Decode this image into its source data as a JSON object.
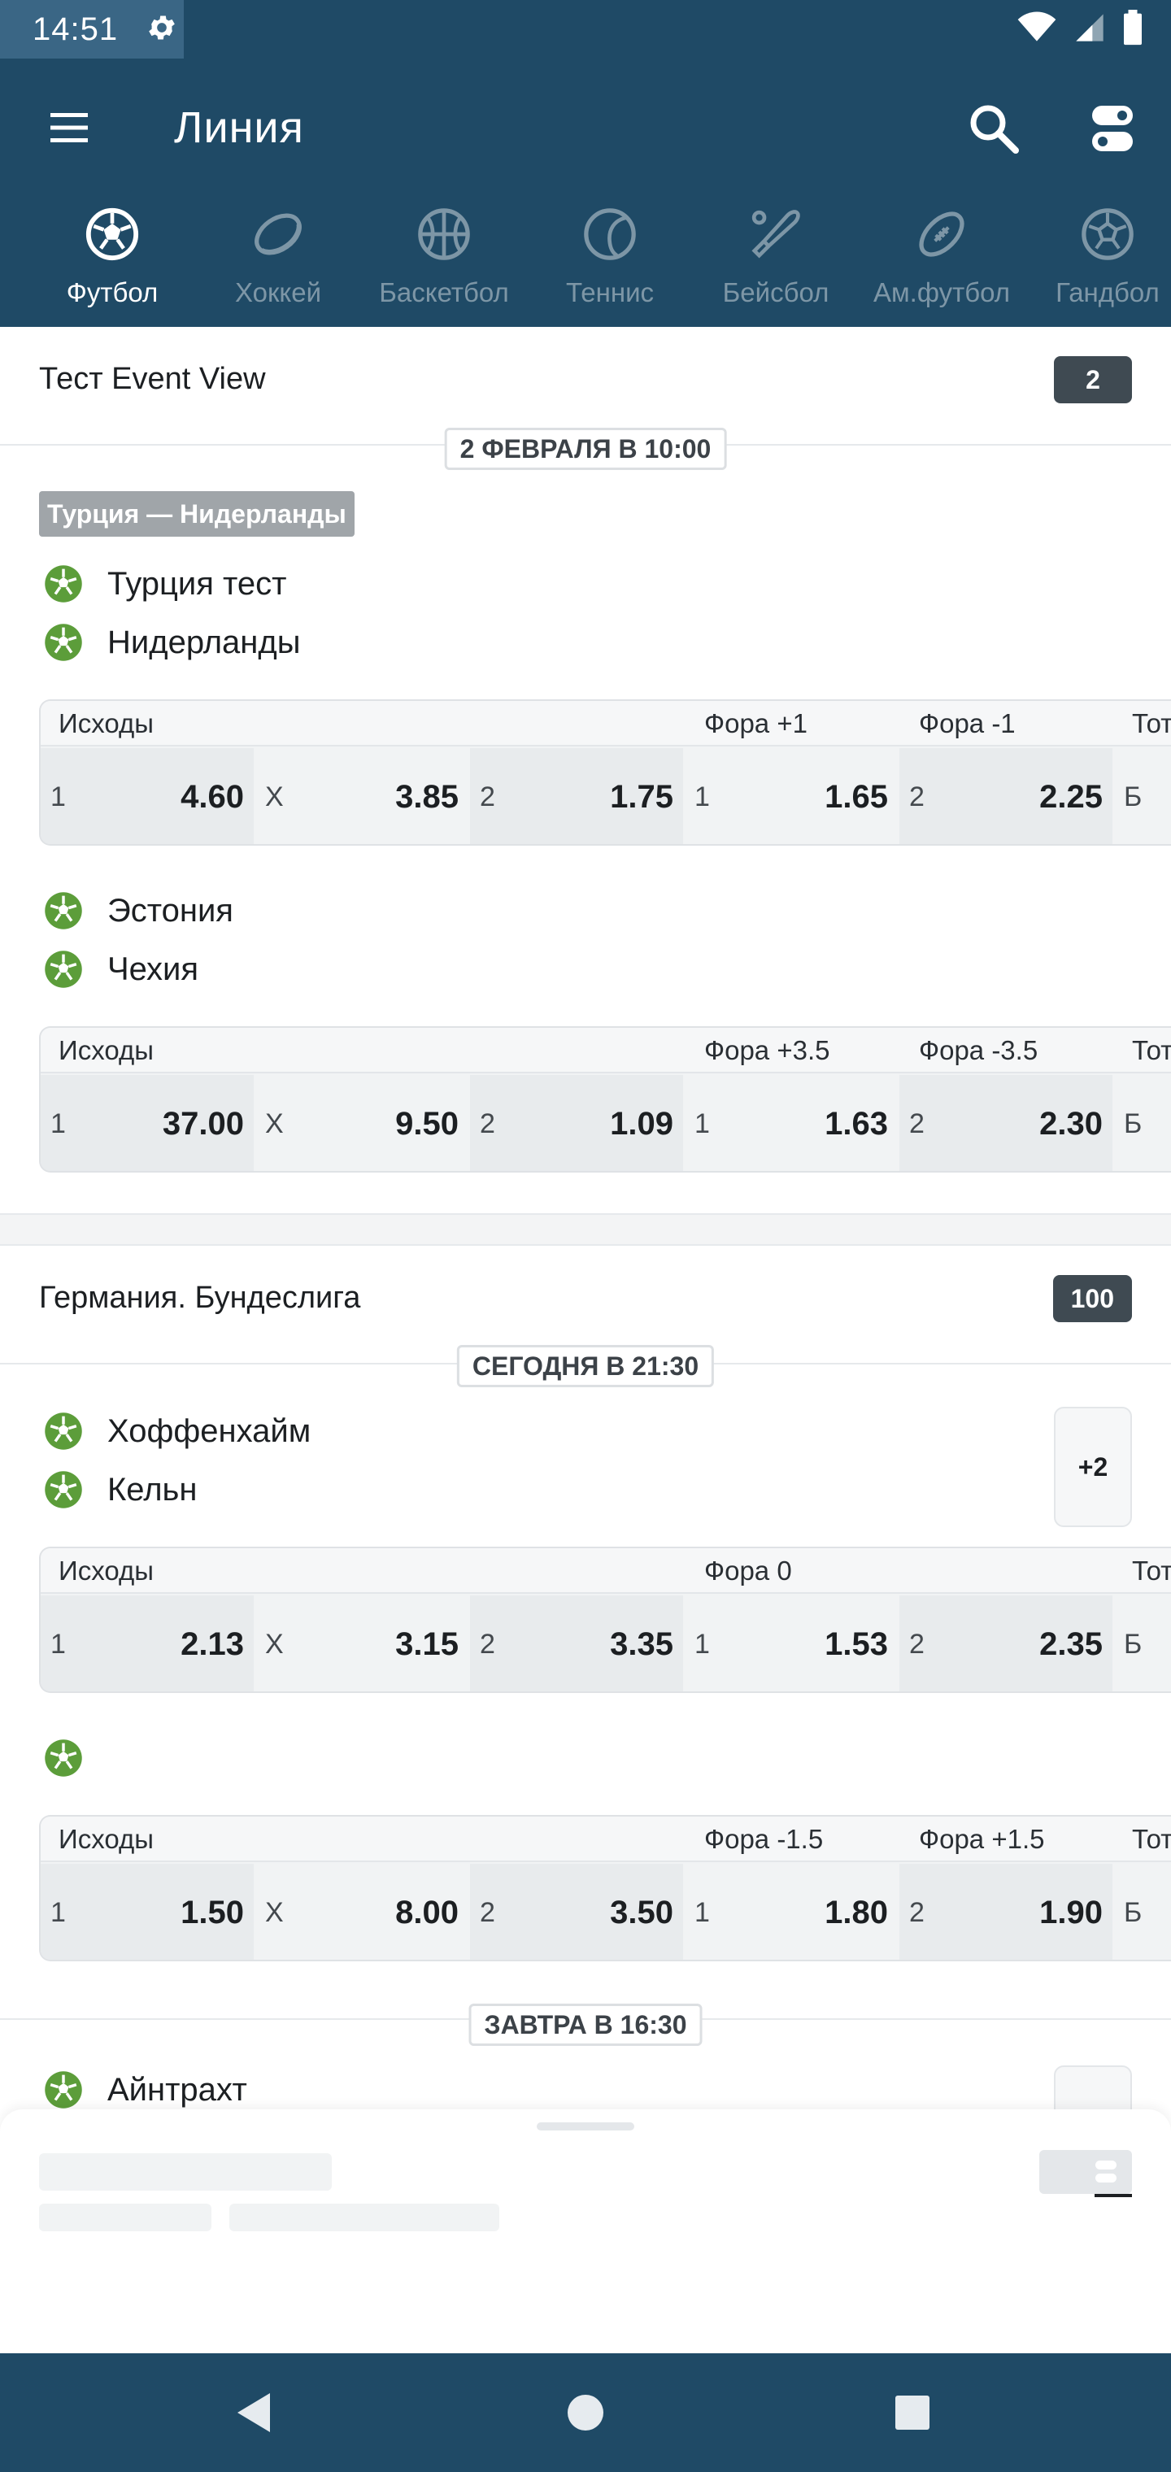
{
  "colors": {
    "primary": "#1f4a66",
    "count_badge": "#3f4a52",
    "soccer_icon": "#5c9d3a"
  },
  "status_bar": {
    "time": "14:51",
    "icons": [
      "gear-icon",
      "wifi-icon",
      "signal-icon",
      "battery-icon"
    ]
  },
  "app_bar": {
    "title": "Линия",
    "icons": [
      "menu-icon",
      "search-icon",
      "toggle-filter-icon"
    ]
  },
  "sports": [
    {
      "label": "Футбол",
      "icon": "soccer-ball-icon",
      "active": true
    },
    {
      "label": "Хоккей",
      "icon": "hockey-puck-icon",
      "active": false
    },
    {
      "label": "Баскетбол",
      "icon": "basketball-icon",
      "active": false
    },
    {
      "label": "Теннис",
      "icon": "tennis-ball-icon",
      "active": false
    },
    {
      "label": "Бейсбол",
      "icon": "baseball-bat-icon",
      "active": false
    },
    {
      "label": "Ам.футбол",
      "icon": "american-football-icon",
      "active": false
    },
    {
      "label": "Гандбол",
      "icon": "handball-icon",
      "active": false
    }
  ],
  "leagues": [
    {
      "name": "Тест Event View",
      "count": "2",
      "date": "2 ФЕВРАЛЯ В 10:00",
      "events": [
        {
          "tag": "Турция — Нидерланды",
          "teams": [
            "Турция тест",
            "Нидерланды"
          ],
          "market_headers": [
            "Исходы",
            "Фора +1",
            "Фора -1",
            "Тот"
          ],
          "odds": [
            {
              "label": "1",
              "value": "4.60"
            },
            {
              "label": "X",
              "value": "3.85"
            },
            {
              "label": "2",
              "value": "1.75"
            },
            {
              "label": "1",
              "value": "1.65"
            },
            {
              "label": "2",
              "value": "2.25"
            },
            {
              "label": "Б",
              "value": ""
            }
          ]
        },
        {
          "teams": [
            "Эстония",
            "Чехия"
          ],
          "market_headers": [
            "Исходы",
            "Фора +3.5",
            "Фора -3.5",
            "Тот"
          ],
          "odds": [
            {
              "label": "1",
              "value": "37.00"
            },
            {
              "label": "X",
              "value": "9.50"
            },
            {
              "label": "2",
              "value": "1.09"
            },
            {
              "label": "1",
              "value": "1.63"
            },
            {
              "label": "2",
              "value": "2.30"
            },
            {
              "label": "Б",
              "value": ""
            }
          ]
        }
      ]
    },
    {
      "name": "Германия. Бундеслига",
      "count": "100",
      "date": "СЕГОДНЯ В 21:30",
      "events": [
        {
          "teams": [
            "Хоффенхайм",
            "Кельн"
          ],
          "more": "+2",
          "market_headers": [
            "Исходы",
            "Фора 0",
            "Тот"
          ],
          "odds": [
            {
              "label": "1",
              "value": "2.13"
            },
            {
              "label": "X",
              "value": "3.15"
            },
            {
              "label": "2",
              "value": "3.35"
            },
            {
              "label": "1",
              "value": "1.53"
            },
            {
              "label": "2",
              "value": "2.35"
            },
            {
              "label": "Б",
              "value": ""
            }
          ]
        },
        {
          "teams": [
            ""
          ],
          "market_headers": [
            "Исходы",
            "Фора -1.5",
            "Фора +1.5",
            "Тот"
          ],
          "odds": [
            {
              "label": "1",
              "value": "1.50"
            },
            {
              "label": "X",
              "value": "8.00"
            },
            {
              "label": "2",
              "value": "3.50"
            },
            {
              "label": "1",
              "value": "1.80"
            },
            {
              "label": "2",
              "value": "1.90"
            },
            {
              "label": "Б",
              "value": ""
            }
          ]
        }
      ],
      "next_date": "ЗАВТРА В 16:30",
      "next_team": "Айнтрахт"
    }
  ],
  "nav_bar": {
    "icons": [
      "back-icon",
      "home-icon",
      "recents-icon"
    ]
  }
}
